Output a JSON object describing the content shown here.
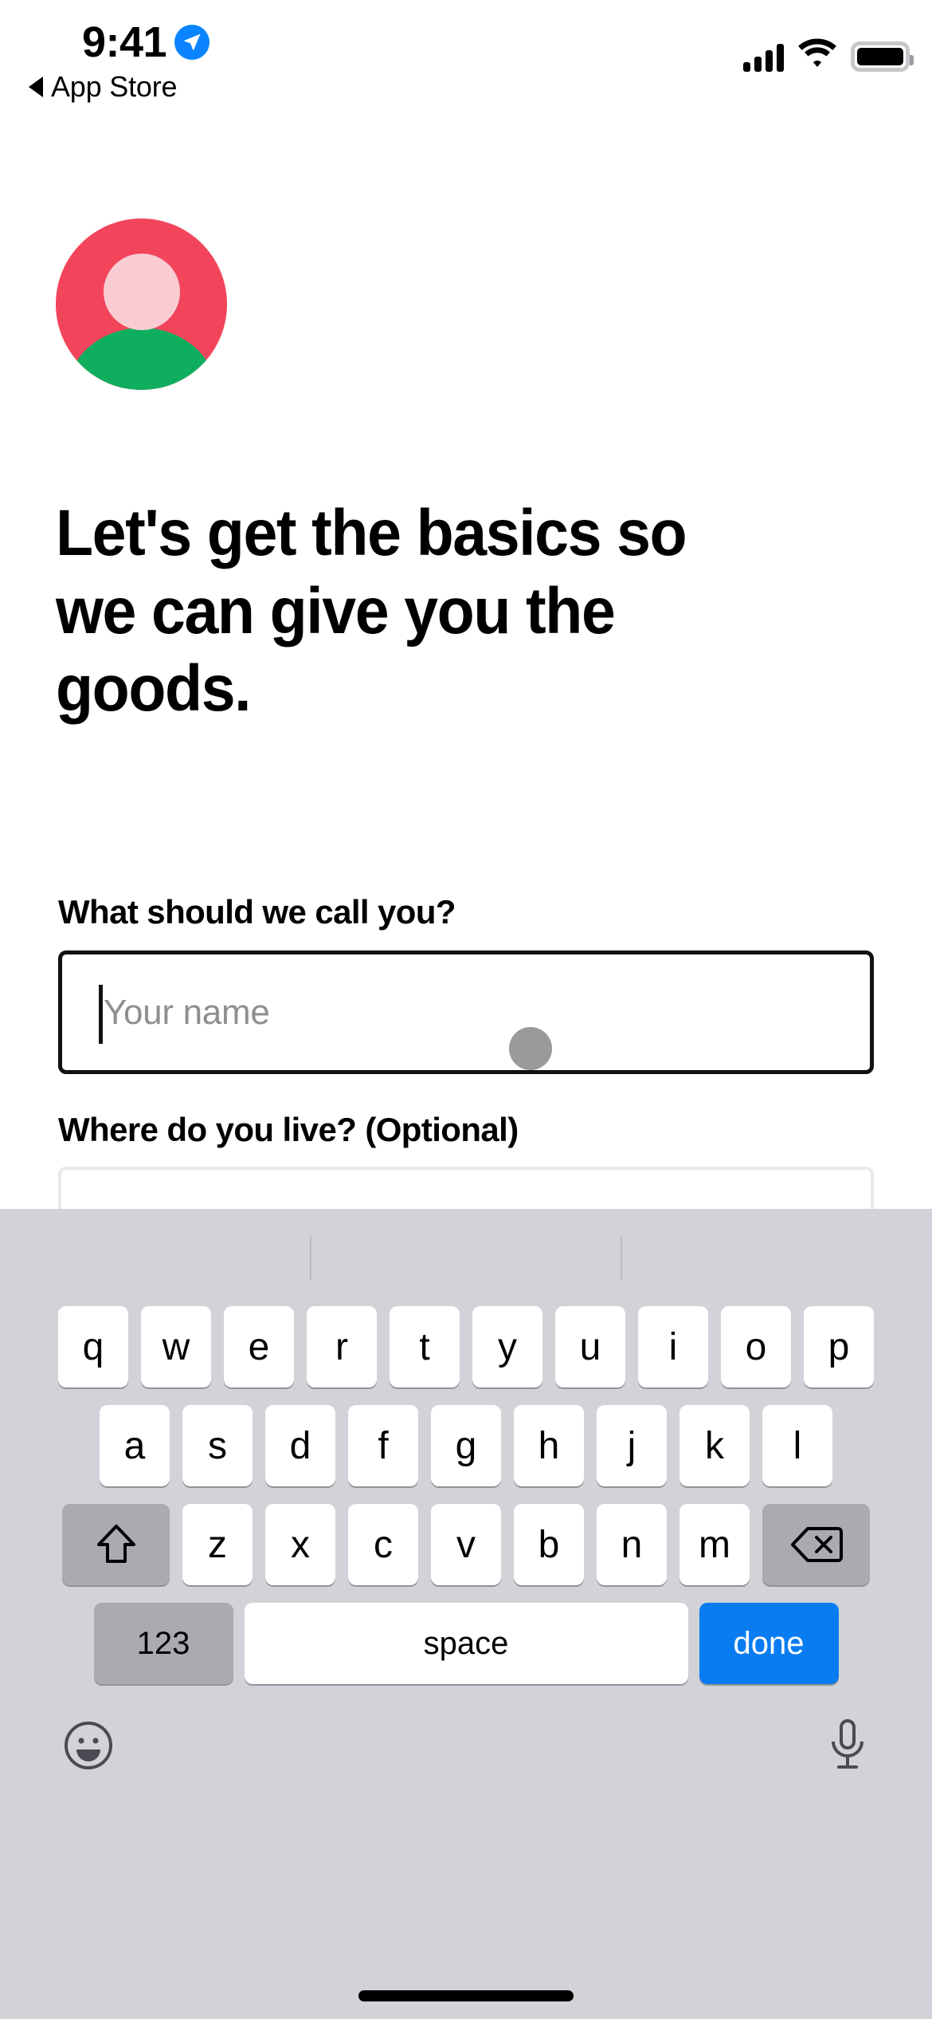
{
  "status_bar": {
    "time": "9:41",
    "location_icon": "location-arrow-icon",
    "cellular_icon": "cellular-signal-icon",
    "wifi_icon": "wifi-icon",
    "battery_icon": "battery-full-icon",
    "accent_blue": "#0a84ff"
  },
  "back_link": {
    "label": "App Store",
    "arrow_icon": "back-triangle-icon"
  },
  "avatar": {
    "name": "profile-avatar",
    "ring_color": "#f2455c",
    "head_color": "#f9ccd2",
    "body_color": "#0fae5e"
  },
  "main": {
    "title": "Let's get the basics so we can give you the goods.",
    "fields": [
      {
        "label": "What should we call you?",
        "placeholder": "Your name",
        "value": "",
        "focused": true,
        "border_color": "#111111"
      },
      {
        "label": "Where do you live? (Optional)",
        "placeholder": "",
        "value": "",
        "focused": false,
        "border_color": "#e9e9ec"
      }
    ]
  },
  "keyboard": {
    "background": "#d1d3d8",
    "row1": [
      "q",
      "w",
      "e",
      "r",
      "t",
      "y",
      "u",
      "i",
      "o",
      "p"
    ],
    "row2": [
      "a",
      "s",
      "d",
      "f",
      "g",
      "h",
      "j",
      "k",
      "l"
    ],
    "row3": [
      "z",
      "x",
      "c",
      "v",
      "b",
      "n",
      "m"
    ],
    "shift_icon": "shift-arrow-icon",
    "backspace_icon": "backspace-delete-icon",
    "numbers_label": "123",
    "space_label": "space",
    "done_label": "done",
    "done_color": "#0a7cf1",
    "emoji_icon": "emoji-smiley-icon",
    "mic_icon": "microphone-icon"
  },
  "home_indicator": "home-indicator-bar"
}
